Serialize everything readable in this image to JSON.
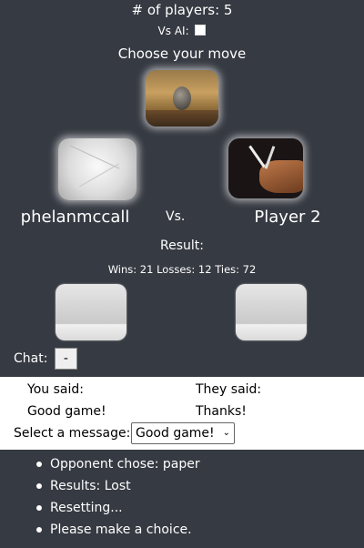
{
  "header": {
    "players_text": "# of players: 5",
    "vs_ai_label": "Vs AI:",
    "vs_ai_checked": false,
    "choose_text": "Choose your move"
  },
  "moves": [
    {
      "name": "rock",
      "icon": "rock-image"
    },
    {
      "name": "paper",
      "icon": "paper-image"
    },
    {
      "name": "scissors",
      "icon": "scissors-image"
    }
  ],
  "matchup": {
    "player1": "phelanmccall",
    "vs": "Vs.",
    "player2": "Player 2"
  },
  "result": {
    "label": "Result:",
    "score_text": "Wins: 21 Losses: 12 Ties: 72"
  },
  "chat": {
    "label": "Chat:",
    "toggle_label": "-",
    "you_said_label": "You said:",
    "they_said_label": "They said:",
    "your_message": "Good game!",
    "their_message": "Thanks!",
    "select_label": "Select a message:",
    "selected_message": "Good game!"
  },
  "log": [
    "Opponent chose: paper",
    "Results: Lost",
    "Resetting...",
    "Please make a choice."
  ],
  "colors": {
    "background": "#363a42",
    "text": "#ffffff",
    "chat_panel": "#ffffff"
  }
}
